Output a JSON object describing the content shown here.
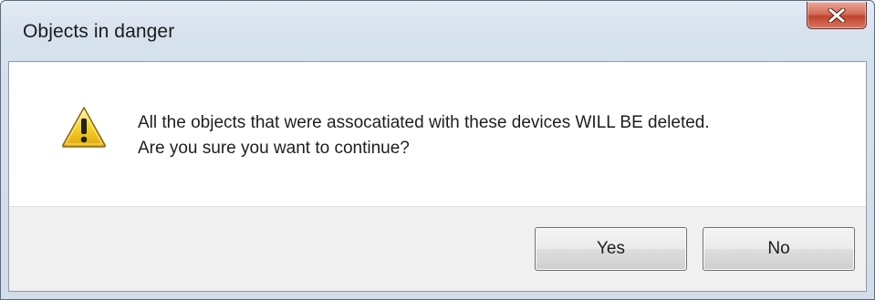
{
  "dialog": {
    "title": "Objects in danger",
    "close_icon": "close-icon",
    "warning_icon": "warning-icon",
    "message_lines": [
      "All the objects that were assocatiated with these devices WILL BE deleted.",
      "Are you sure you want to continue?"
    ],
    "buttons": {
      "yes_label": "Yes",
      "no_label": "No"
    },
    "colors": {
      "close_button": "#c0452d",
      "warning_yellow": "#f2c81a"
    }
  }
}
